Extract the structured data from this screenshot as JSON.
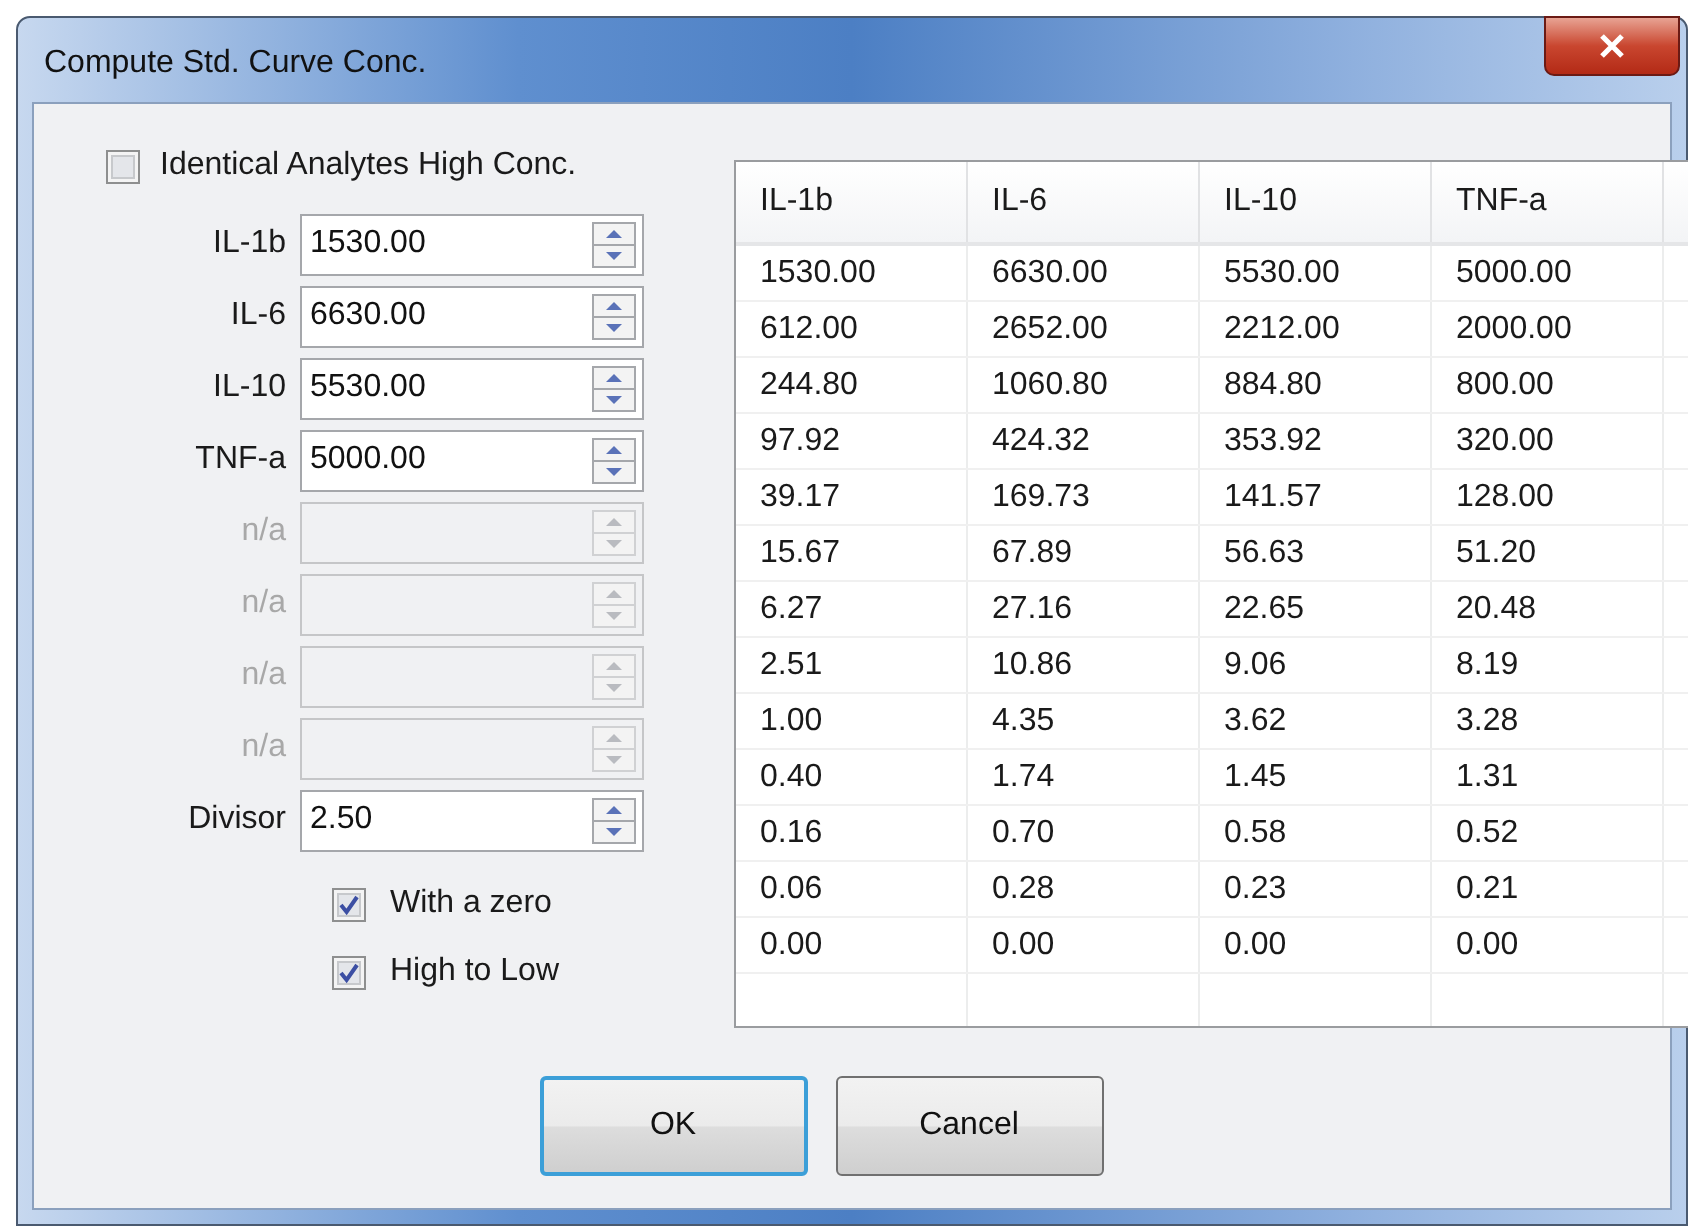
{
  "window": {
    "title": "Compute Std. Curve Conc."
  },
  "identical": {
    "label": "Identical Analytes High Conc.",
    "checked": false
  },
  "fields": [
    {
      "label": "IL-1b",
      "value": "1530.00",
      "disabled": false
    },
    {
      "label": "IL-6",
      "value": "6630.00",
      "disabled": false
    },
    {
      "label": "IL-10",
      "value": "5530.00",
      "disabled": false
    },
    {
      "label": "TNF-a",
      "value": "5000.00",
      "disabled": false
    },
    {
      "label": "n/a",
      "disabled": true
    },
    {
      "label": "n/a",
      "disabled": true
    },
    {
      "label": "n/a",
      "disabled": true
    },
    {
      "label": "n/a",
      "disabled": true
    },
    {
      "label": "Divisor",
      "value": "2.50",
      "disabled": false
    }
  ],
  "options": [
    {
      "label": "With a zero",
      "checked": true
    },
    {
      "label": "High to Low",
      "checked": true
    }
  ],
  "table": {
    "columns": [
      "IL-1b",
      "IL-6",
      "IL-10",
      "TNF-a"
    ],
    "rows": [
      [
        "1530.00",
        "6630.00",
        "5530.00",
        "5000.00"
      ],
      [
        "612.00",
        "2652.00",
        "2212.00",
        "2000.00"
      ],
      [
        "244.80",
        "1060.80",
        "884.80",
        "800.00"
      ],
      [
        "97.92",
        "424.32",
        "353.92",
        "320.00"
      ],
      [
        "39.17",
        "169.73",
        "141.57",
        "128.00"
      ],
      [
        "15.67",
        "67.89",
        "56.63",
        "51.20"
      ],
      [
        "6.27",
        "27.16",
        "22.65",
        "20.48"
      ],
      [
        "2.51",
        "10.86",
        "9.06",
        "8.19"
      ],
      [
        "1.00",
        "4.35",
        "3.62",
        "3.28"
      ],
      [
        "0.40",
        "1.74",
        "1.45",
        "1.31"
      ],
      [
        "0.16",
        "0.70",
        "0.58",
        "0.52"
      ],
      [
        "0.06",
        "0.28",
        "0.23",
        "0.21"
      ],
      [
        "0.00",
        "0.00",
        "0.00",
        "0.00"
      ]
    ]
  },
  "buttons": [
    {
      "label": "OK",
      "default": true
    },
    {
      "label": "Cancel",
      "default": false
    }
  ]
}
